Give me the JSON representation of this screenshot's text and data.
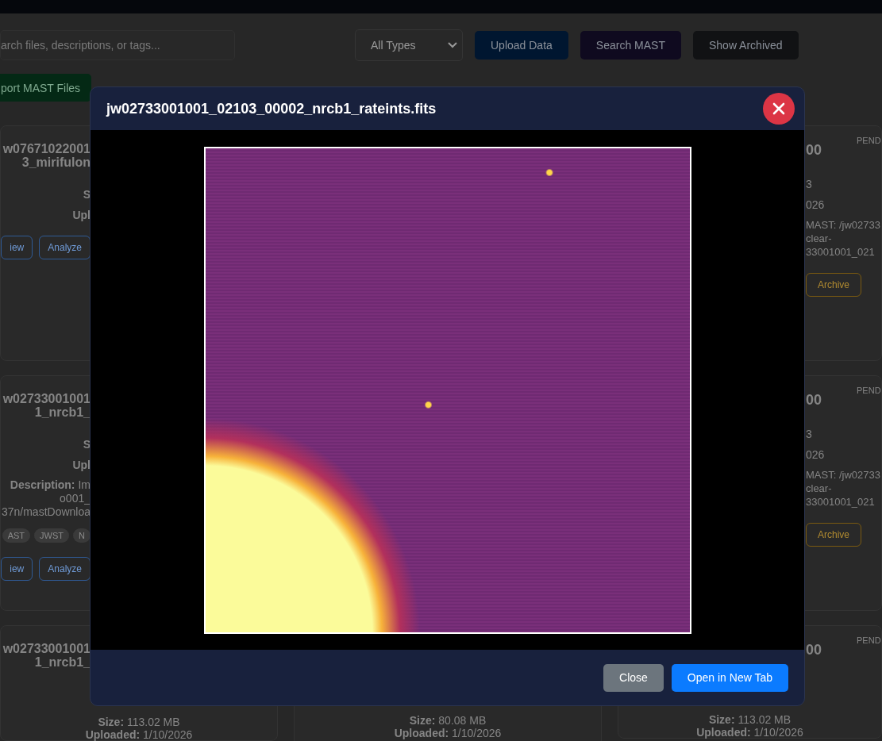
{
  "toolbar": {
    "search": {
      "placeholder": "arch files, descriptions, or tags..."
    },
    "type_filter": {
      "value": "All Types"
    },
    "buttons": [
      {
        "label": "Upload Data",
        "kind": "blue"
      },
      {
        "label": "Search MAST",
        "kind": "purple"
      },
      {
        "label": "Show Archived",
        "kind": "dark"
      }
    ],
    "import_button": {
      "label": "port MAST Files"
    }
  },
  "left_column": [
    {
      "title_lines": [
        "w07671022001",
        "3_mirifulon"
      ],
      "size": "S",
      "uploaded": "Upl",
      "buttons": [
        {
          "label": "iew",
          "kind": "outline"
        },
        {
          "label": "Analyze",
          "kind": "outline"
        }
      ]
    },
    {
      "title_lines": [
        "w02733001001",
        "1_nrcb1_"
      ],
      "size": "S",
      "uploaded": "Upl",
      "description": [
        "**Description:** Im",
        "o001_",
        "37n/mastDownloa"
      ],
      "tags": [
        "AST",
        "JWST",
        "N"
      ],
      "buttons": [
        {
          "label": "iew",
          "kind": "outline"
        },
        {
          "label": "Analyze",
          "kind": "outline"
        }
      ]
    },
    {
      "title_lines": [
        "w02733001001",
        "1_nrcb1_"
      ],
      "size_full": "**Size:** 113.02 MB",
      "uploaded_full": "**Uploaded:** 1/10/2026"
    }
  ],
  "middle_column": [
    {
      "size_full": "**Size:** 80.08 MB",
      "uploaded_full": "**Uploaded:** 1/10/2026"
    }
  ],
  "right_column": [
    {
      "title": "00",
      "status": "PEND",
      "size": "3",
      "uploaded": "026",
      "description": [
        "MAST: /jw02733",
        "clear-",
        "33001001_021"
      ],
      "buttons": [
        {
          "label": "Archive",
          "kind": "warning"
        }
      ]
    },
    {
      "title": "00",
      "status": "PEND",
      "size": "3",
      "uploaded": "026",
      "description": [
        "MAST: /jw02733",
        "clear-",
        "33001001_021"
      ],
      "buttons": [
        {
          "label": "Archive",
          "kind": "warning"
        }
      ]
    },
    {
      "title": "00",
      "status": "PEND",
      "size_full": "**Size:** 113.02 MB",
      "uploaded_full": "**Uploaded:** 1/10/2026"
    }
  ],
  "modal": {
    "title": "jw02733001001_02103_00002_nrcb1_rateints.fits",
    "buttons": [
      {
        "label": "Close",
        "kind": "secondary"
      },
      {
        "label": "Open in New Tab",
        "kind": "primary"
      }
    ]
  }
}
